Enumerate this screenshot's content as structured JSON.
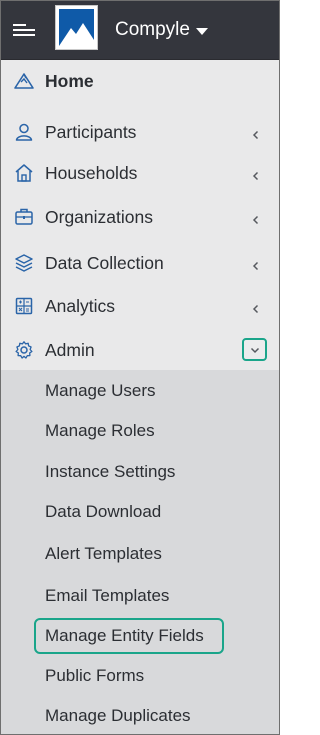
{
  "header": {
    "brand": "Compyle",
    "menu_icon": "hamburger-icon",
    "logo_icon": "mountain-logo-icon",
    "brand_caret_icon": "caret-down-icon"
  },
  "nav": {
    "items": [
      {
        "label": "Home",
        "icon": "triangle-home-icon",
        "bold": true,
        "chevron": false
      },
      {
        "label": "Participants",
        "icon": "user-icon",
        "chevron": true
      },
      {
        "label": "Households",
        "icon": "house-icon",
        "chevron": true
      },
      {
        "label": "Organizations",
        "icon": "briefcase-icon",
        "chevron": true
      },
      {
        "label": "Data Collection",
        "icon": "layers-icon",
        "chevron": true
      },
      {
        "label": "Analytics",
        "icon": "calculator-icon",
        "chevron": true
      },
      {
        "label": "Admin",
        "icon": "gear-icon",
        "chevron": "down",
        "expanded": true
      }
    ]
  },
  "admin_submenu": {
    "items": [
      {
        "label": "Manage Users"
      },
      {
        "label": "Manage Roles"
      },
      {
        "label": "Instance Settings"
      },
      {
        "label": "Data Download"
      },
      {
        "label": "Alert Templates"
      },
      {
        "label": "Email Templates"
      },
      {
        "label": "Manage Entity Fields",
        "highlighted": true
      },
      {
        "label": "Public Forms"
      },
      {
        "label": "Manage Duplicates"
      }
    ]
  },
  "colors": {
    "header_bg": "#34363d",
    "sidebar_bg": "#e9e9ea",
    "submenu_bg": "#d8d9db",
    "highlight": "#1aa58a",
    "text": "#2b2e33"
  }
}
